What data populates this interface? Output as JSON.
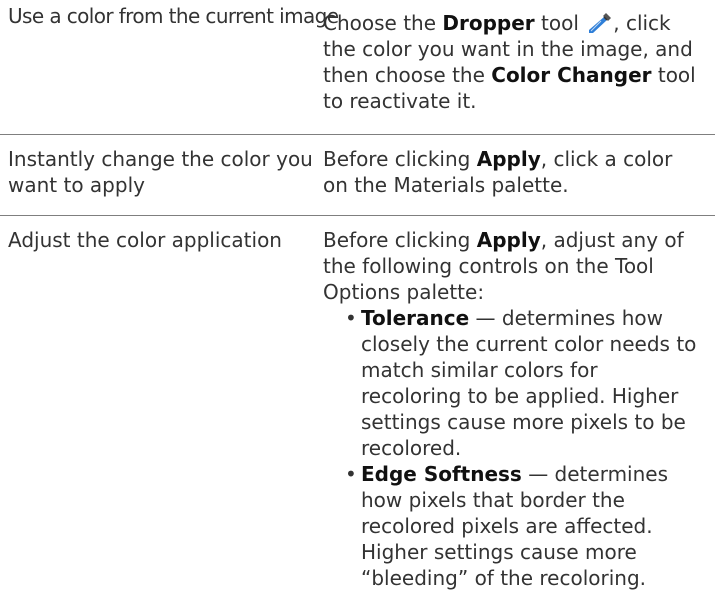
{
  "rows": [
    {
      "action": "Use a color from the current image",
      "instructions": {
        "t1": "Choose the ",
        "b1": "Dropper",
        "t2": " tool ",
        "icon": "dropper-icon",
        "t3": ", click the color you want in the image, and then choose the ",
        "b2": "Color Changer",
        "t4": " tool to reactivate it."
      }
    },
    {
      "action": "Instantly change the color you want to apply",
      "instructions": {
        "t1": "Before clicking ",
        "b1": "Apply",
        "t2": ", click a color on the Materials palette."
      }
    },
    {
      "action": "Adjust the color application",
      "instructions": {
        "t1": "Before clicking ",
        "b1": "Apply",
        "t2": ", adjust any of the following controls on the Tool Options palette:",
        "bullets": [
          {
            "term": "Tolerance",
            "desc": " — determines how closely the current color needs to match similar colors for recoloring to be applied. Higher settings cause more pixels to be recolored."
          },
          {
            "term": "Edge Softness",
            "desc": " — determines how pixels that border the recolored pixels are affected. Higher settings cause more “bleeding” of the recoloring."
          }
        ]
      }
    }
  ],
  "bullet_char": "•",
  "colors": {
    "text": "#333333",
    "divider": "#7f7f7f",
    "icon_blue": "#2f7fd8"
  }
}
